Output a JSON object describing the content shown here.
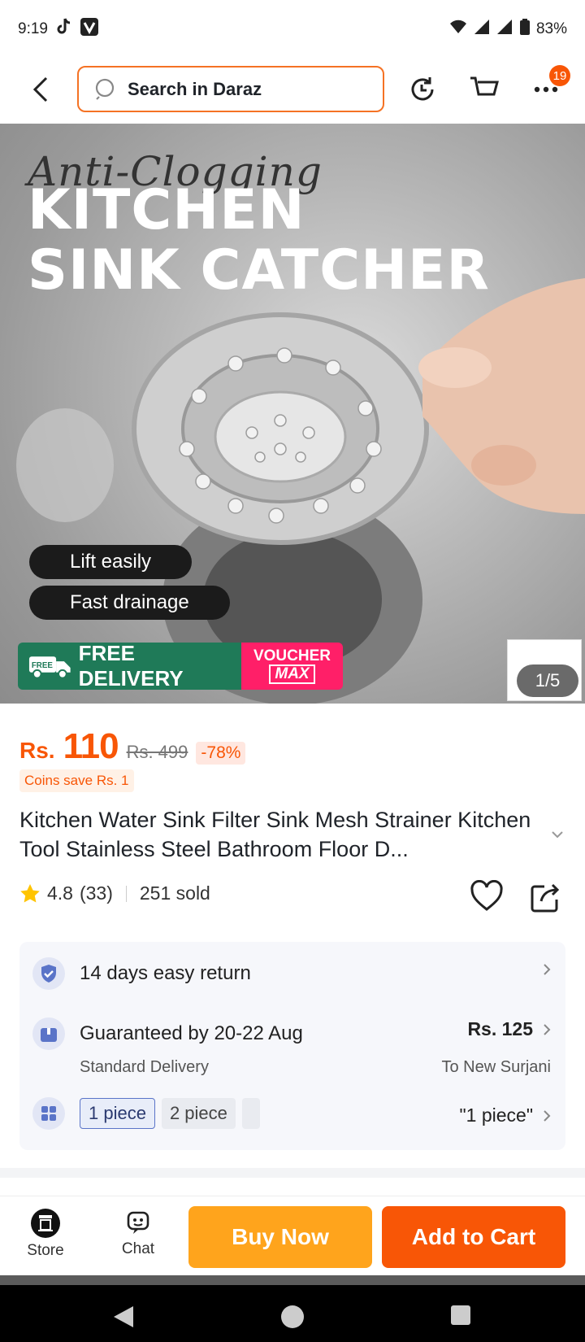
{
  "status": {
    "time": "9:19",
    "battery": "83%"
  },
  "header": {
    "search_placeholder": "Search in Daraz",
    "more_badge": "19"
  },
  "hero": {
    "script_text": "Anti-Clogging",
    "title_line1": "KITCHEN",
    "title_line2": "SINK CATCHER",
    "pill1": "Lift easily",
    "pill2": "Fast drainage",
    "free_label": "FREE",
    "free_delivery": "FREE DELIVERY",
    "voucher_line1": "VOUCHER",
    "voucher_line2": "MAX",
    "counter": "1/5"
  },
  "price": {
    "currency": "Rs.",
    "current": "110",
    "original": "Rs. 499",
    "discount": "-78%",
    "coins": "Coins save Rs. 1"
  },
  "product": {
    "title": "Kitchen Water Sink Filter Sink Mesh Strainer Kitchen Tool Stainless Steel Bathroom Floor D...",
    "rating": "4.8",
    "reviews": "(33)",
    "sold": "251 sold"
  },
  "info": {
    "returns": "14 days easy return",
    "delivery_title": "Guaranteed by 20-22 Aug",
    "delivery_sub": "Standard Delivery",
    "delivery_price": "Rs. 125",
    "delivery_to": "To New Surjani",
    "variants": [
      "1 piece",
      "2 piece"
    ],
    "selected_variant": "\"1 piece\""
  },
  "bottom": {
    "store": "Store",
    "chat": "Chat",
    "buy_now": "Buy Now",
    "add_to_cart": "Add to Cart"
  },
  "colors": {
    "accent": "#f85606",
    "buy": "#ffa41c",
    "free_green": "#1f7a58",
    "voucher_pink": "#ff1f68"
  }
}
